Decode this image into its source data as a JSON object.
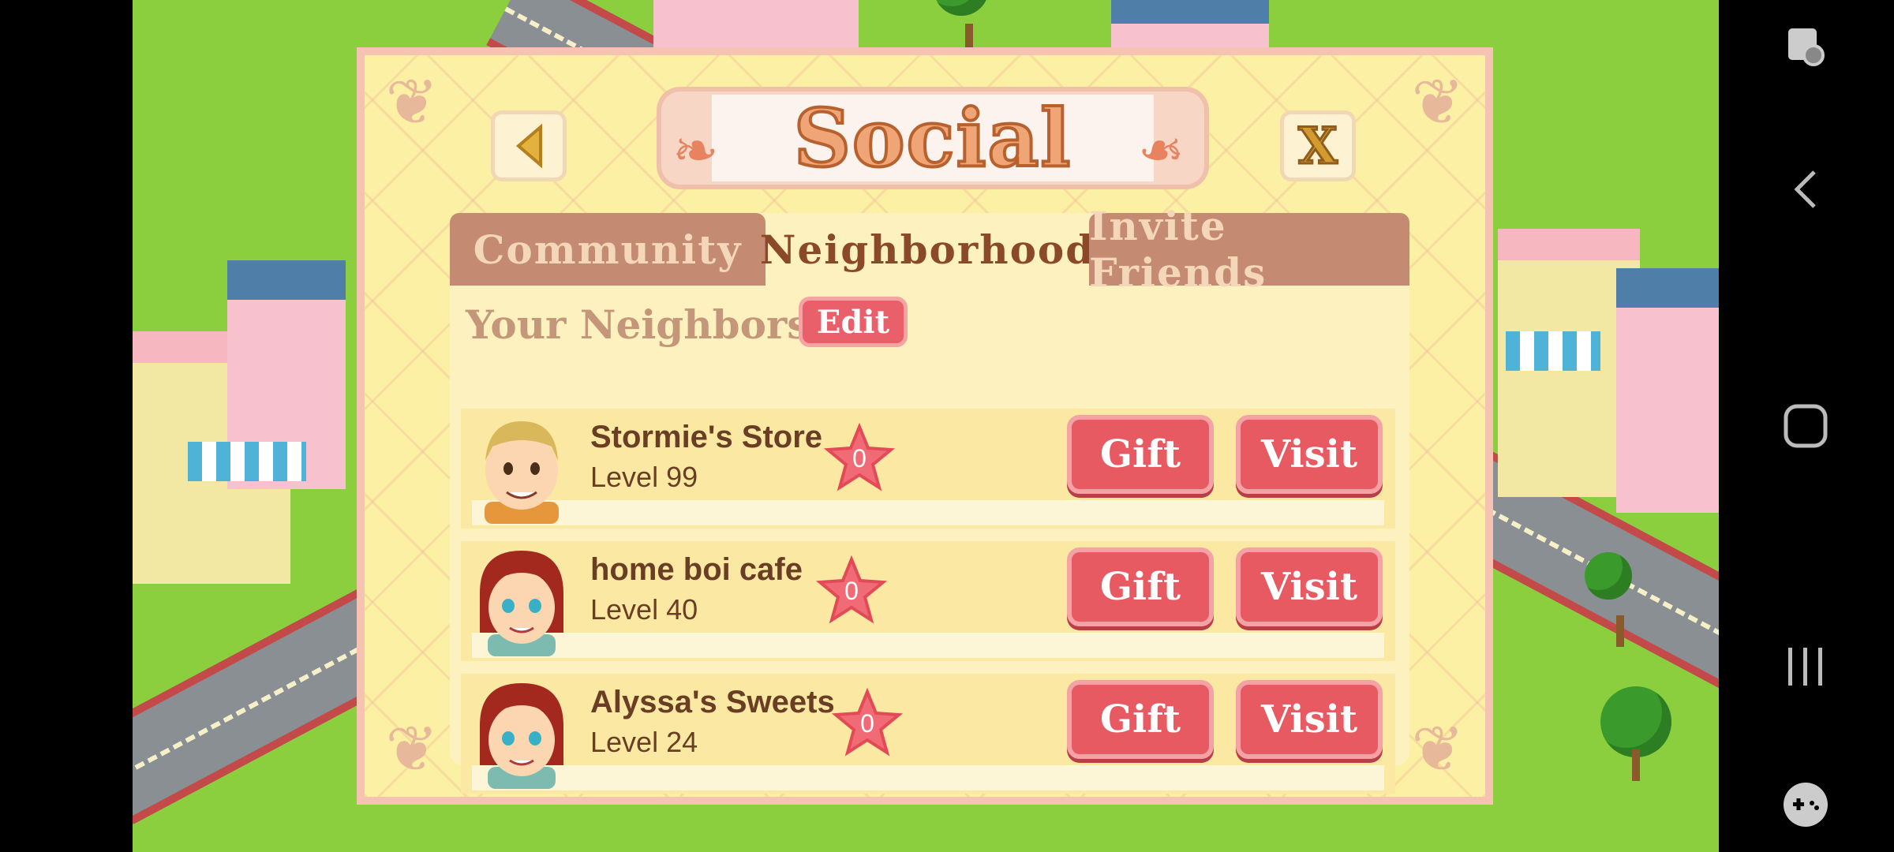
{
  "dialog": {
    "title": "Social",
    "close_label": "X"
  },
  "tabs": [
    {
      "label": "Community",
      "active": false
    },
    {
      "label": "Neighborhood",
      "active": true
    },
    {
      "label": "Invite Friends",
      "active": false
    }
  ],
  "neighbors_section": {
    "heading": "Your Neighbors",
    "edit_label": "Edit"
  },
  "neighbors": [
    {
      "name": "Stormie's Store",
      "level": "Level 99",
      "stars": "0",
      "avatar": "blonde-man",
      "gift_label": "Gift",
      "visit_label": "Visit"
    },
    {
      "name": " home boi cafe",
      "level": "Level 40",
      "stars": "0",
      "avatar": "red-haired-woman",
      "gift_label": "Gift",
      "visit_label": "Visit"
    },
    {
      "name": "Alyssa's Sweets",
      "level": "Level 24",
      "stars": "0",
      "avatar": "red-haired-woman",
      "gift_label": "Gift",
      "visit_label": "Visit"
    }
  ],
  "colors": {
    "accent_button": "#e75a62",
    "dialog_bg": "#fbf0a4",
    "tab_inactive": "#c58b72",
    "grass": "#8ccf3e"
  },
  "navbar_icons": [
    "screen-capture-icon",
    "back-arrow-icon",
    "home-icon",
    "recents-icon",
    "game-tools-icon"
  ]
}
